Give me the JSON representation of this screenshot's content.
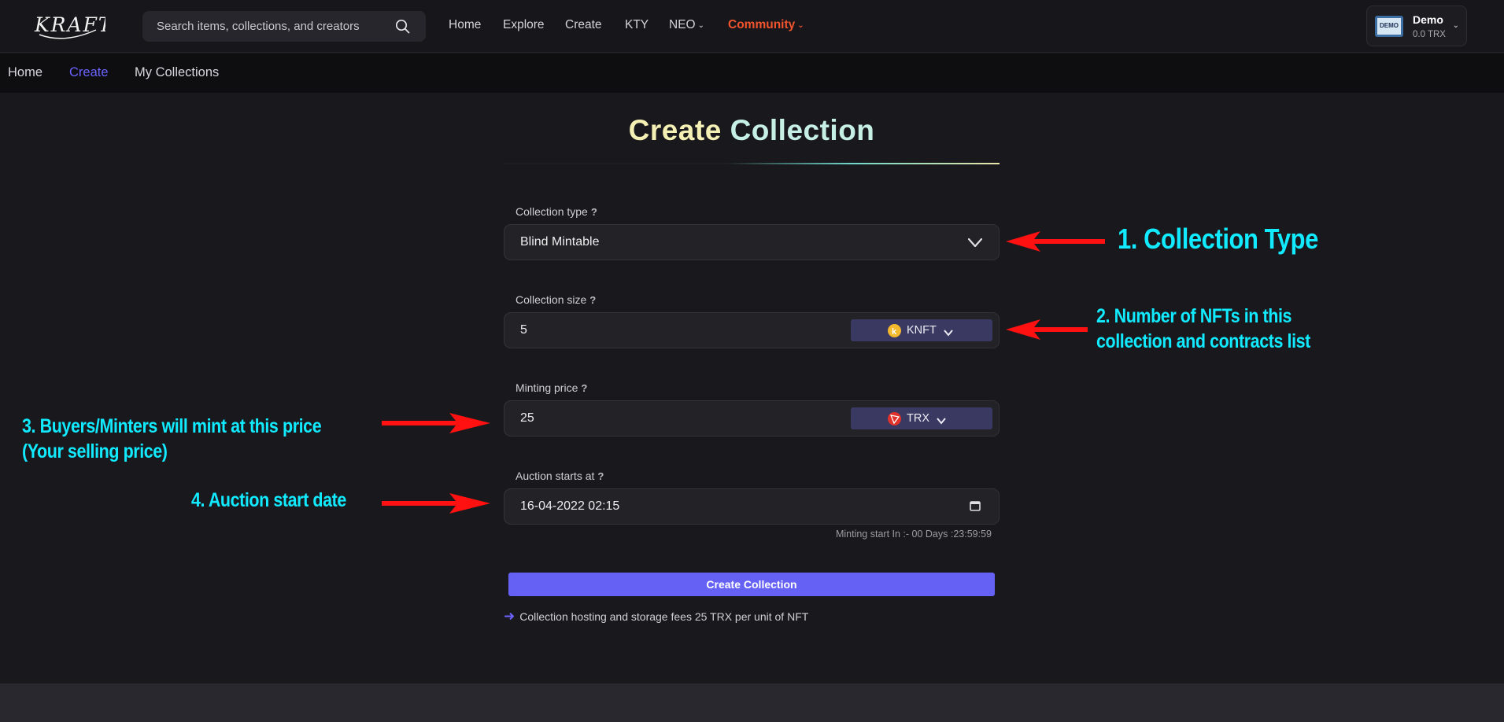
{
  "app": {
    "logo": "KRAFTLY"
  },
  "search": {
    "placeholder": "Search items, collections, and creators"
  },
  "nav": {
    "items": [
      {
        "label": "Home"
      },
      {
        "label": "Explore"
      },
      {
        "label": "Create"
      },
      {
        "label": "KTY"
      },
      {
        "label": "NEO",
        "dropdown": true
      },
      {
        "label": "Community",
        "dropdown": true,
        "color": "#f2542d"
      }
    ]
  },
  "account": {
    "avatar_text": "DEMO",
    "name": "Demo",
    "balance": "0.0 TRX"
  },
  "subnav": {
    "items": [
      {
        "label": "Home"
      },
      {
        "label": "Create",
        "active": true
      },
      {
        "label": "My Collections"
      }
    ],
    "accent": "#6c63ff"
  },
  "page": {
    "title_part1": "Create",
    "title_part2": "Collection"
  },
  "form": {
    "collection_type": {
      "label": "Collection type",
      "value": "Blind Mintable"
    },
    "collection_size": {
      "label": "Collection size",
      "value": "5",
      "token": "KNFT"
    },
    "minting_price": {
      "label": "Minting price",
      "value": "25",
      "currency": "TRX"
    },
    "auction_start": {
      "label": "Auction starts at",
      "value": "16-04-2022 02:15"
    },
    "countdown": "Minting start In :- 00 Days :23:59:59",
    "submit_label": "Create Collection",
    "fee_note": "Collection hosting and storage fees 25 TRX per unit of NFT",
    "button_color": "#6461f4"
  },
  "annotations": {
    "a1": "1. Collection Type",
    "a2_line1": "2. Number of NFTs in this",
    "a2_line2": "collection and contracts list",
    "a3_line1": "3. Buyers/Minters will mint at this price",
    "a3_line2": "(Your selling price)",
    "a4": "4. Auction start date",
    "text_color": "#11eaff",
    "arrow_color": "#ff1111"
  }
}
